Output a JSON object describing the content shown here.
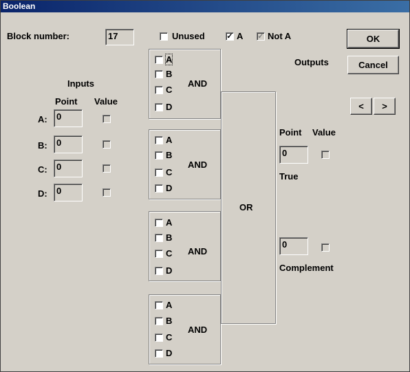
{
  "window": {
    "title": "Boolean"
  },
  "header": {
    "block_number_label": "Block number:",
    "block_number_value": "17",
    "unused_label": "Unused",
    "unused_checked": false,
    "a_label": "A",
    "a_checked": true,
    "not_a_label": "Not A",
    "not_a_checked": true,
    "not_a_disabled": true
  },
  "buttons": {
    "ok": "OK",
    "cancel": "Cancel",
    "prev": "<",
    "next": ">"
  },
  "inputs": {
    "title": "Inputs",
    "point_header": "Point",
    "value_header": "Value",
    "rows": [
      {
        "label": "A:",
        "point": "0",
        "value_checked": false
      },
      {
        "label": "B:",
        "point": "0",
        "value_checked": false
      },
      {
        "label": "C:",
        "point": "0",
        "value_checked": false
      },
      {
        "label": "D:",
        "point": "0",
        "value_checked": false
      }
    ]
  },
  "and_blocks": [
    {
      "gate": "AND",
      "items": [
        "A",
        "B",
        "C",
        "D"
      ]
    },
    {
      "gate": "AND",
      "items": [
        "A",
        "B",
        "C",
        "D"
      ]
    },
    {
      "gate": "AND",
      "items": [
        "A",
        "B",
        "C",
        "D"
      ]
    },
    {
      "gate": "AND",
      "items": [
        "A",
        "B",
        "C",
        "D"
      ]
    }
  ],
  "or_block": {
    "label": "OR"
  },
  "outputs": {
    "title": "Outputs",
    "point_header": "Point",
    "value_header": "Value",
    "true_point": "0",
    "true_label": "True",
    "complement_point": "0",
    "complement_label": "Complement"
  }
}
